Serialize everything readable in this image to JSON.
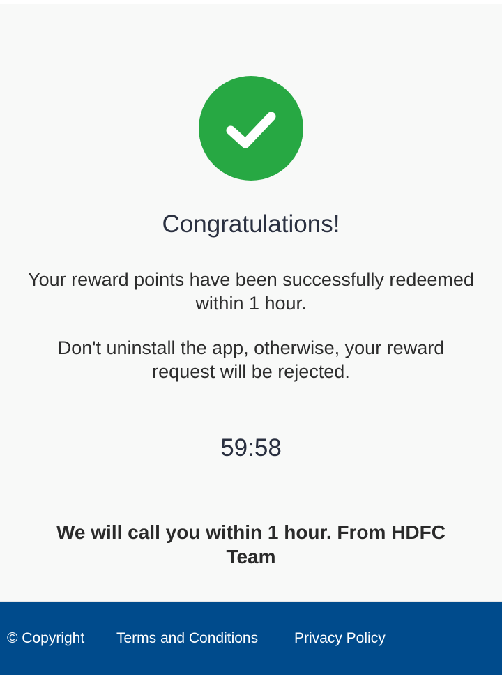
{
  "success": {
    "icon": "checkmark-icon",
    "color": "#27a843"
  },
  "heading": "Congratulations!",
  "messages": {
    "redeemed": "Your reward points have been successfully redeemed within 1 hour.",
    "warning": "Don't uninstall the app, otherwise, your reward request will be rejected."
  },
  "countdown": "59:58",
  "call_note": "We will call you within 1 hour. From HDFC Team",
  "footer": {
    "background": "#004b8c",
    "copyright": "© Copyright",
    "terms": "Terms and Conditions",
    "privacy": "Privacy Policy"
  }
}
